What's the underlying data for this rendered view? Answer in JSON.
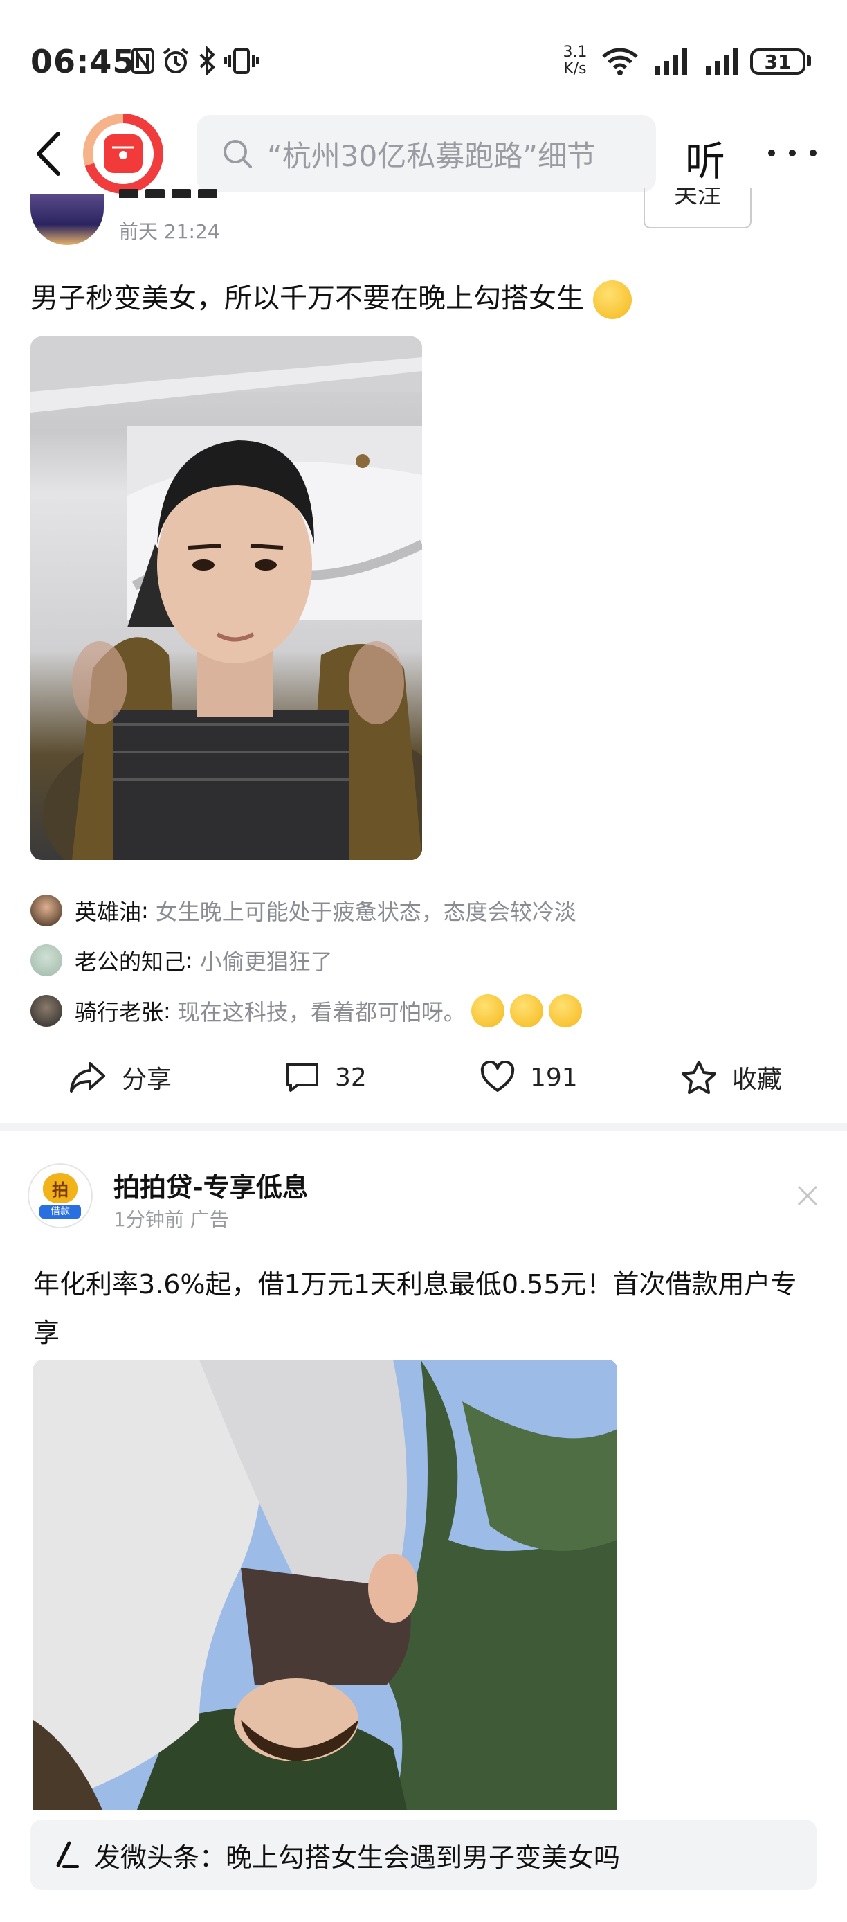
{
  "status_bar": {
    "time": "06:45",
    "net_rate_value": "3.1",
    "net_rate_unit": "K/s",
    "battery": "31"
  },
  "nav": {
    "search_placeholder": "“杭州30亿私募跑路”细节",
    "listen_label": "听"
  },
  "post1": {
    "time": "前天  21:24",
    "follow_label": "关注",
    "text": "男子秒变美女，所以千万不要在晚上勾搭女生",
    "comments": [
      {
        "name": "英雄油",
        "text": "女生晚上可能处于疲惫状态，态度会较冷淡"
      },
      {
        "name": "老公的知己",
        "text": "小偷更猖狂了"
      },
      {
        "name": "骑行老张",
        "text": "现在这科技，看着都可怕呀。"
      }
    ],
    "actions": {
      "share": "分享",
      "comments": "32",
      "likes": "191",
      "favorite": "收藏"
    }
  },
  "post2": {
    "avatar_glyph": "拍",
    "avatar_tag": "借款",
    "name": "拍拍贷-专享低息",
    "meta": "1分钟前  广告",
    "text": "年化利率3.6%起，借1万元1天利息最低0.55元！首次借款用户专享"
  },
  "bottom_bar": {
    "prompt": "发微头条：晚上勾搭女生会遇到男子变美女吗"
  },
  "colors": {
    "brand_red": "#f33a3a",
    "muted_text": "#8d8f94",
    "search_bg": "#f2f3f5"
  }
}
